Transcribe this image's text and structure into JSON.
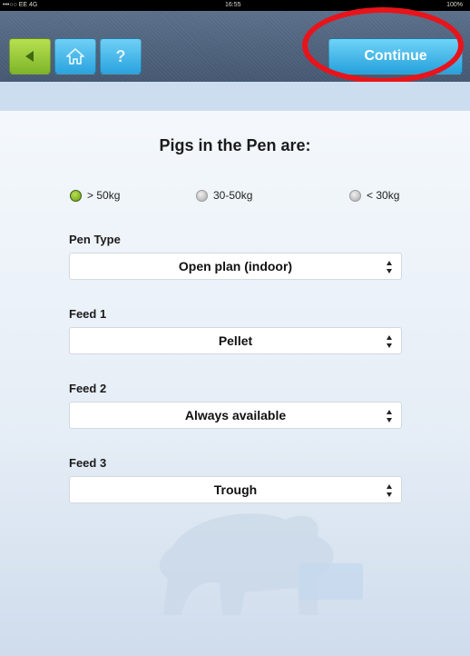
{
  "status_bar": {
    "carrier": "•••○○ EE  4G",
    "time": "16:55",
    "battery": "100%"
  },
  "toolbar": {
    "back_icon": "back-arrow-icon",
    "home_icon": "home-icon",
    "help_label": "?",
    "continue_label": "Continue"
  },
  "page": {
    "title": "Pigs in the Pen are:"
  },
  "weight_options": [
    {
      "label": "> 50kg",
      "selected": true
    },
    {
      "label": "30-50kg",
      "selected": false
    },
    {
      "label": "< 30kg",
      "selected": false
    }
  ],
  "fields": [
    {
      "label": "Pen Type",
      "value": "Open plan (indoor)"
    },
    {
      "label": "Feed 1",
      "value": "Pellet"
    },
    {
      "label": "Feed 2",
      "value": "Always available"
    },
    {
      "label": "Feed 3",
      "value": "Trough"
    }
  ],
  "colors": {
    "accent_green": "#8cc23a",
    "accent_blue": "#2aa3df",
    "annotation_red": "#e8141b",
    "toolbar": "#4f627c"
  }
}
